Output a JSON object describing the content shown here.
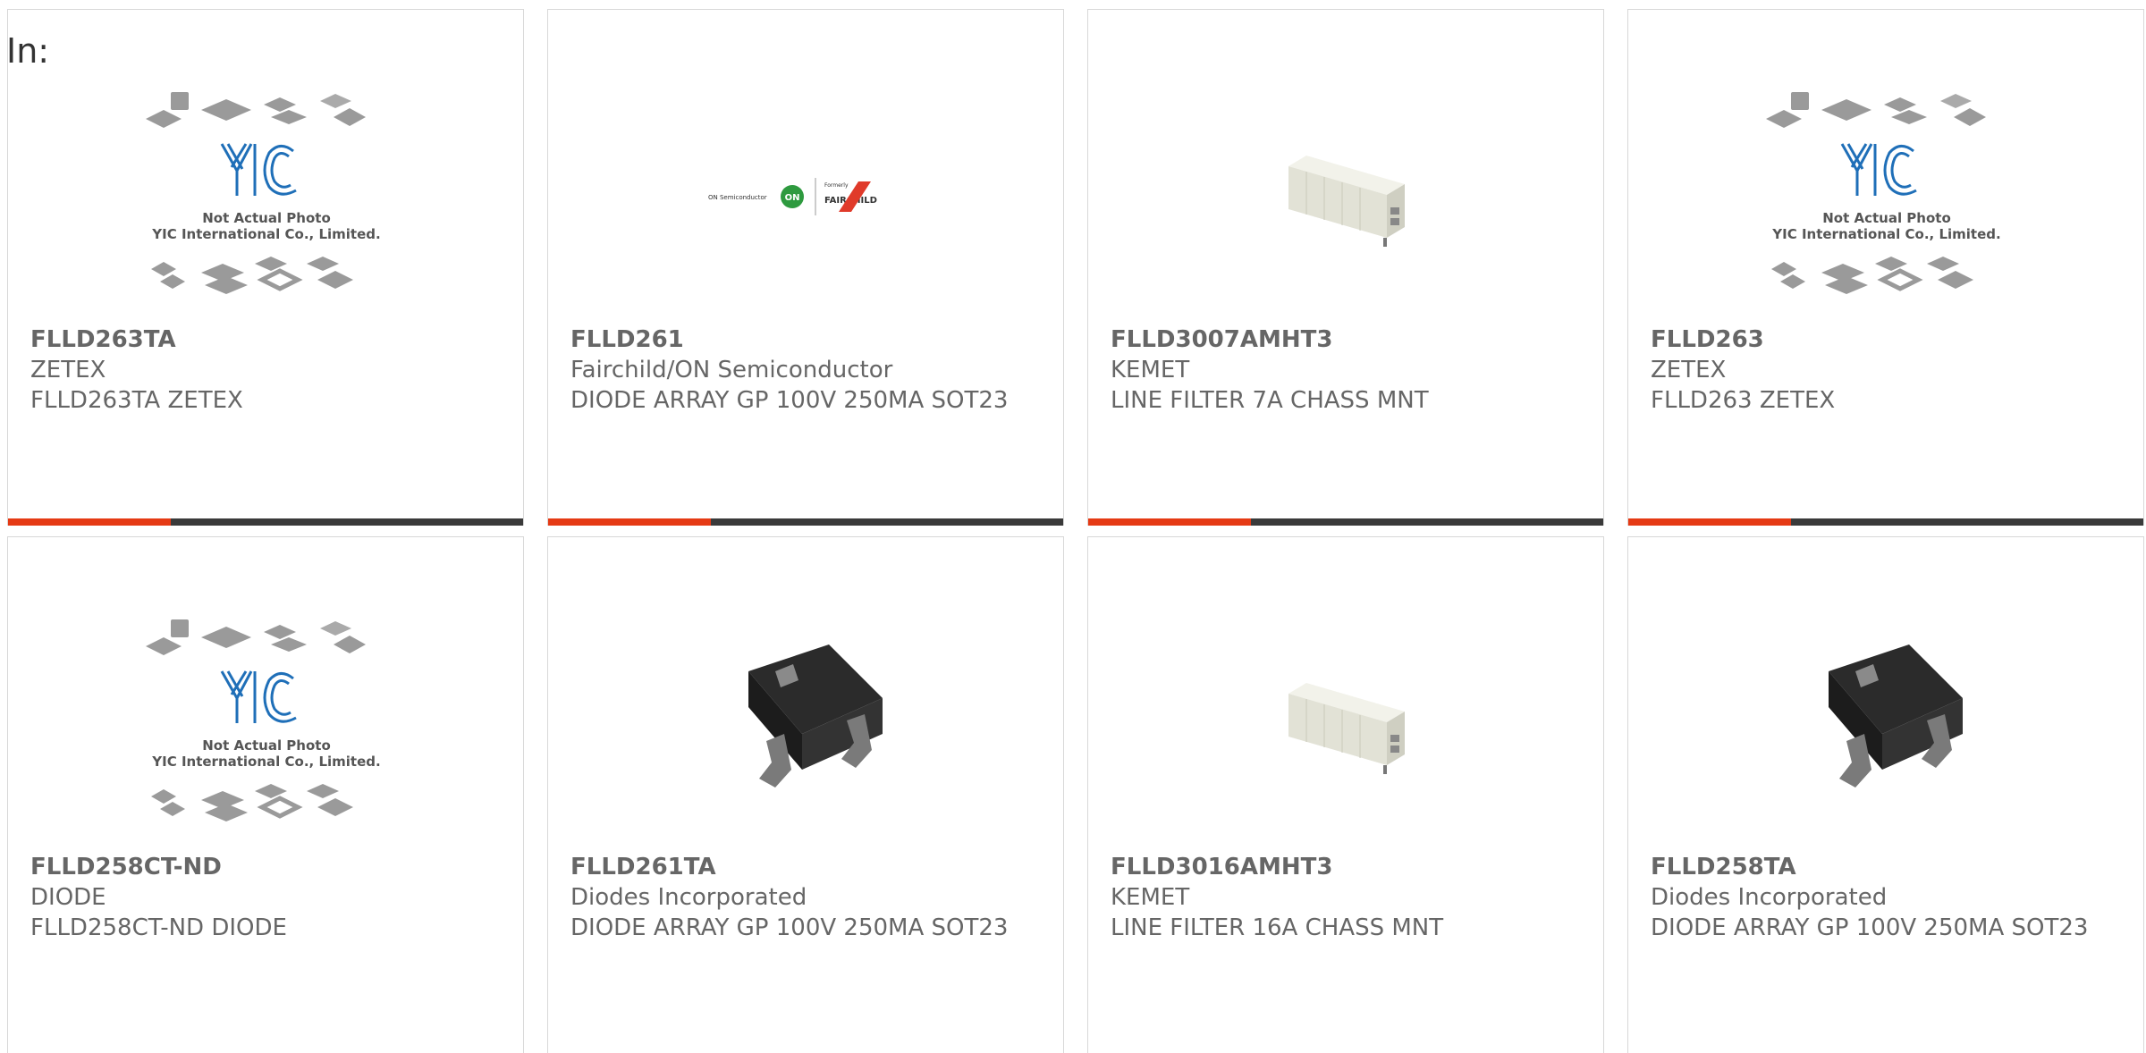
{
  "page": {
    "label": "In:"
  },
  "colors": {
    "accent": "#e53a14",
    "bar": "#3a3a3a",
    "border": "#d8d8d8",
    "text": "#666666"
  },
  "cards": [
    {
      "part_number": "FLLD263TA",
      "manufacturer": "ZETEX",
      "description": "FLLD263TA ZETEX",
      "image": "yic-placeholder-icon",
      "placeholder_text": [
        "Not Actual Photo",
        "YIC International Co., Limited."
      ],
      "brand_text": "YIC"
    },
    {
      "part_number": "FLLD261",
      "manufacturer": "Fairchild/ON Semiconductor",
      "description": "DIODE ARRAY GP 100V 250MA SOT23",
      "image": "on-fairchild-logo-icon",
      "logo_text": [
        "ON Semiconductor",
        "ON",
        "Formerly",
        "FAIRCHILD"
      ]
    },
    {
      "part_number": "FLLD3007AMHT3",
      "manufacturer": "KEMET",
      "description": "LINE FILTER 7A CHASS MNT",
      "image": "line-filter-photo-icon"
    },
    {
      "part_number": "FLLD263",
      "manufacturer": "ZETEX",
      "description": "FLLD263 ZETEX",
      "image": "yic-placeholder-icon",
      "placeholder_text": [
        "Not Actual Photo",
        "YIC International Co., Limited."
      ],
      "brand_text": "YIC"
    },
    {
      "part_number": "FLLD258CT-ND",
      "manufacturer": "DIODE",
      "description": "FLLD258CT-ND DIODE",
      "image": "yic-placeholder-icon",
      "placeholder_text": [
        "Not Actual Photo",
        "YIC International Co., Limited."
      ],
      "brand_text": "YIC"
    },
    {
      "part_number": "FLLD261TA",
      "manufacturer": "Diodes Incorporated",
      "description": "DIODE ARRAY GP 100V 250MA SOT23",
      "image": "sot23-package-icon"
    },
    {
      "part_number": "FLLD3016AMHT3",
      "manufacturer": "KEMET",
      "description": "LINE FILTER 16A CHASS MNT",
      "image": "line-filter-photo-icon"
    },
    {
      "part_number": "FLLD258TA",
      "manufacturer": "Diodes Incorporated",
      "description": "DIODE ARRAY GP 100V 250MA SOT23",
      "image": "sot23-package-icon"
    }
  ]
}
